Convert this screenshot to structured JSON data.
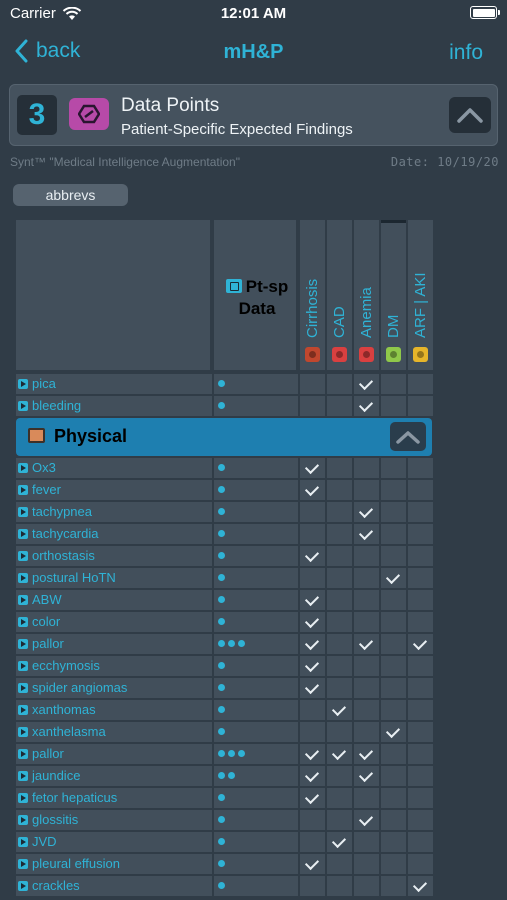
{
  "status": {
    "carrier": "Carrier",
    "time": "12:01 AM"
  },
  "nav": {
    "back": "back",
    "title": "mH&P",
    "info": "info"
  },
  "card": {
    "step": "3",
    "title": "Data Points",
    "subtitle": "Patient-Specific Expected Findings"
  },
  "tagline": "Synt™ \"Medical Intelligence Augmentation\"",
  "date": "Date: 10/19/20",
  "abbrevs": "abbrevs",
  "grid": {
    "pt_header": {
      "line1": "Pt-sp",
      "line2": "Data"
    },
    "diagnoses": [
      {
        "name": "Cirrhosis",
        "color": "#c0472e"
      },
      {
        "name": "CAD",
        "color": "#d94040"
      },
      {
        "name": "Anemia",
        "color": "#d94040"
      },
      {
        "name": "DM",
        "color": "#8fc84a"
      },
      {
        "name": "ARF | AKI",
        "color": "#e6b52a"
      }
    ],
    "section": "Physical",
    "rows_before": [
      {
        "label": "pica",
        "dots": 1,
        "checks": [
          false,
          false,
          true,
          false,
          false
        ]
      },
      {
        "label": "bleeding",
        "dots": 1,
        "checks": [
          false,
          false,
          true,
          false,
          false
        ]
      }
    ],
    "rows_after": [
      {
        "label": "Ox3",
        "dots": 1,
        "checks": [
          true,
          false,
          false,
          false,
          false
        ]
      },
      {
        "label": "fever",
        "dots": 1,
        "checks": [
          true,
          false,
          false,
          false,
          false
        ]
      },
      {
        "label": "tachypnea",
        "dots": 1,
        "checks": [
          false,
          false,
          true,
          false,
          false
        ]
      },
      {
        "label": "tachycardia",
        "dots": 1,
        "checks": [
          false,
          false,
          true,
          false,
          false
        ]
      },
      {
        "label": "orthostasis",
        "dots": 1,
        "checks": [
          true,
          false,
          false,
          false,
          false
        ]
      },
      {
        "label": "postural HoTN",
        "dots": 1,
        "checks": [
          false,
          false,
          false,
          true,
          false
        ]
      },
      {
        "label": "ABW",
        "dots": 1,
        "checks": [
          true,
          false,
          false,
          false,
          false
        ]
      },
      {
        "label": "color",
        "dots": 1,
        "checks": [
          true,
          false,
          false,
          false,
          false
        ]
      },
      {
        "label": "pallor",
        "dots": 3,
        "checks": [
          true,
          false,
          true,
          false,
          true
        ]
      },
      {
        "label": "ecchymosis",
        "dots": 1,
        "checks": [
          true,
          false,
          false,
          false,
          false
        ]
      },
      {
        "label": "spider angiomas",
        "dots": 1,
        "checks": [
          true,
          false,
          false,
          false,
          false
        ]
      },
      {
        "label": "xanthomas",
        "dots": 1,
        "checks": [
          false,
          true,
          false,
          false,
          false
        ]
      },
      {
        "label": "xanthelasma",
        "dots": 1,
        "checks": [
          false,
          false,
          false,
          true,
          false
        ]
      },
      {
        "label": "pallor",
        "dots": 3,
        "checks": [
          true,
          true,
          true,
          false,
          false
        ]
      },
      {
        "label": "jaundice",
        "dots": 2,
        "checks": [
          true,
          false,
          true,
          false,
          false
        ]
      },
      {
        "label": "fetor hepaticus",
        "dots": 1,
        "checks": [
          true,
          false,
          false,
          false,
          false
        ]
      },
      {
        "label": "glossitis",
        "dots": 1,
        "checks": [
          false,
          false,
          true,
          false,
          false
        ]
      },
      {
        "label": "JVD",
        "dots": 1,
        "checks": [
          false,
          true,
          false,
          false,
          false
        ]
      },
      {
        "label": "pleural effusion",
        "dots": 1,
        "checks": [
          true,
          false,
          false,
          false,
          false
        ]
      },
      {
        "label": "crackles",
        "dots": 1,
        "checks": [
          false,
          false,
          false,
          false,
          true
        ]
      }
    ]
  }
}
